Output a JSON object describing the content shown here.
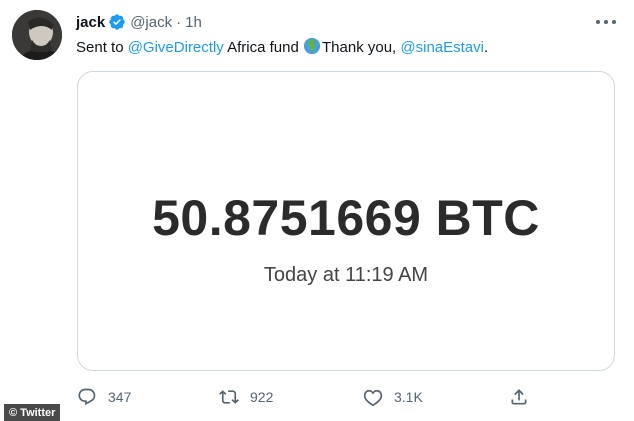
{
  "author": {
    "name": "jack",
    "handle": "@jack",
    "separator": "·",
    "time": "1h"
  },
  "tweet": {
    "text_before": "Sent to ",
    "mention1": "@GiveDirectly",
    "text_middle": " Africa fund ",
    "emoji": "globe-africa-emoji",
    "text_after": "Thank you, ",
    "mention2": "@sinaEstavi",
    "text_end": "."
  },
  "card": {
    "amount": "50.8751669 BTC",
    "timestamp": "Today at 11:19 AM"
  },
  "actions": {
    "reply_count": "347",
    "retweet_count": "922",
    "like_count": "3.1K"
  },
  "watermark": "© Twitter",
  "colors": {
    "link": "#1d9bf0",
    "secondary_text": "#536471",
    "border": "#cfd9de",
    "verified": "#1d9bf0"
  },
  "icons": [
    "verified-badge-icon",
    "more-options-icon",
    "reply-icon",
    "retweet-icon",
    "like-icon",
    "share-icon"
  ]
}
